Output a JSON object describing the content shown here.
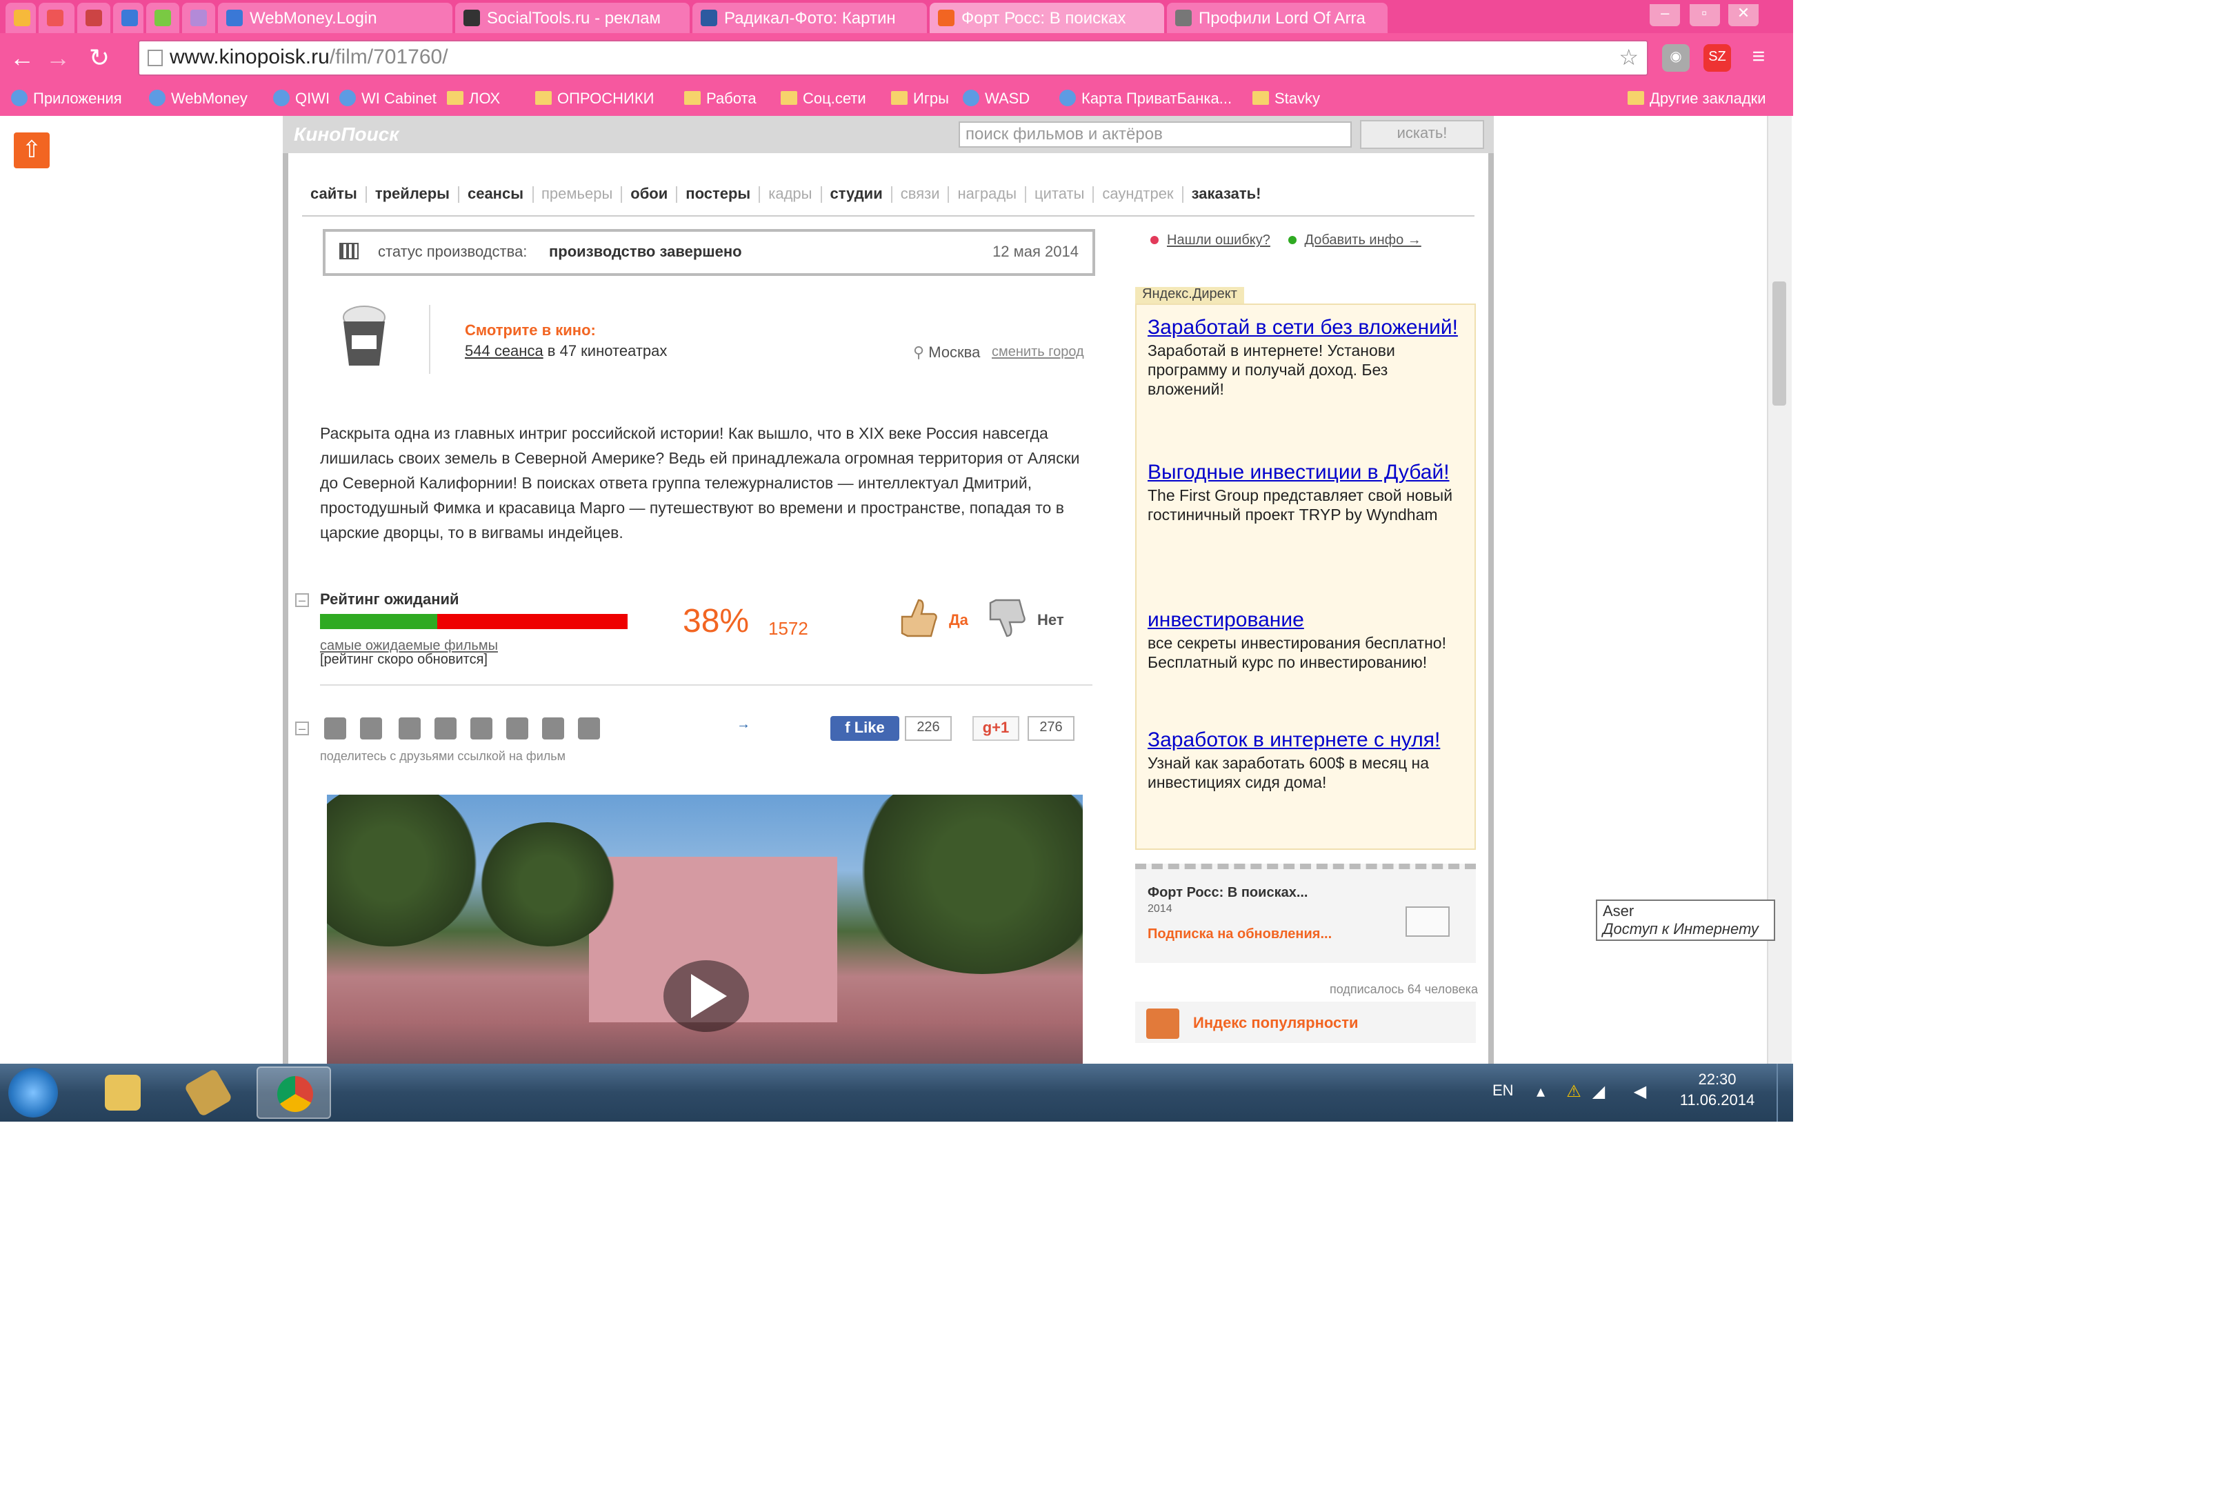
{
  "browser": {
    "tabs": [
      {
        "label": "",
        "color": "#f6b93b"
      },
      {
        "label": "",
        "color": "#e55"
      },
      {
        "label": "",
        "color": "#c44"
      },
      {
        "label": "",
        "color": "#3b7ad8"
      },
      {
        "label": "",
        "color": "#7ac943"
      },
      {
        "label": "",
        "color": "#b38ad8"
      },
      {
        "label": "WebMoney.Login",
        "color": "#3a78d6"
      },
      {
        "label": "SocialTools.ru - реклам",
        "color": "#333"
      },
      {
        "label": "Радикал-Фото: Картин",
        "color": "#2c5aa0"
      },
      {
        "label": "Форт Росс: В поисках",
        "color": "#f26522"
      },
      {
        "label": "Профили Lord Of Arra",
        "color": "#777"
      }
    ],
    "url_host": "www.kinopoisk.ru",
    "url_path": "/film/701760/",
    "window_buttons": [
      "–",
      "▫",
      "✕"
    ],
    "bookmarks": [
      {
        "label": "Приложения",
        "icon": "apps-icon"
      },
      {
        "label": "WebMoney",
        "icon": "webmoney-icon"
      },
      {
        "label": "QIWI",
        "icon": "qiwi-icon"
      },
      {
        "label": "WI Cabinet",
        "icon": "cabinet-icon"
      },
      {
        "label": "ЛОХ",
        "icon": "folder-icon"
      },
      {
        "label": "ОПРОСНИКИ",
        "icon": "folder-icon"
      },
      {
        "label": "Работа",
        "icon": "folder-icon"
      },
      {
        "label": "Соц.сети",
        "icon": "folder-icon"
      },
      {
        "label": "Игры",
        "icon": "folder-icon"
      },
      {
        "label": "WASD",
        "icon": "wasd-icon"
      },
      {
        "label": "Карта ПриватБанка...",
        "icon": "privat-icon"
      },
      {
        "label": "Stavky",
        "icon": "folder-icon"
      }
    ],
    "other_bookmarks": "Другие закладки"
  },
  "site": {
    "logo": "КиноПоиск",
    "search_placeholder": "поиск фильмов и актёров",
    "search_button": "искать!",
    "menu": [
      {
        "label": "сайты",
        "style": "normal"
      },
      {
        "label": "трейлеры",
        "style": "normal"
      },
      {
        "label": "сеансы",
        "style": "normal"
      },
      {
        "label": "премьеры",
        "style": "dim"
      },
      {
        "label": "обои",
        "style": "normal"
      },
      {
        "label": "постеры",
        "style": "normal"
      },
      {
        "label": "кадры",
        "style": "dim"
      },
      {
        "label": "студии",
        "style": "normal"
      },
      {
        "label": "связи",
        "style": "dim"
      },
      {
        "label": "награды",
        "style": "dim"
      },
      {
        "label": "цитаты",
        "style": "dim"
      },
      {
        "label": "саундтрек",
        "style": "dim"
      },
      {
        "label": "заказать!",
        "style": "normal"
      }
    ],
    "status": {
      "label": "статус производства:",
      "value": "производство завершено",
      "date": "12 мая 2014"
    },
    "cinema": {
      "title": "Смотрите в кино:",
      "sessions": "544 сеанса",
      "suffix": " в 47 кинотеатрах",
      "city": "Москва",
      "change_city": "сменить город"
    },
    "description": "Раскрыта одна из главных интриг российской истории! Как вышло, что в XIX веке Россия навсегда лишилась своих земель в Северной Америке? Ведь ей принадлежала огромная территория от Аляски до Северной Калифорнии! В поисках ответа группа тележурналистов — интеллектуал Дмитрий, простодушный Фимка и красавица Марго — путешествуют во времени и пространстве, попадая то в царские дворцы, то в вигвамы индейцев.",
    "rating": {
      "label": "Рейтинг ожиданий",
      "percent_value": 38,
      "percent": "38%",
      "count": "1572",
      "link": "самые ожидаемые фильмы",
      "note": "[рейтинг скоро обновится]",
      "yes": "Да",
      "no": "Нет",
      "bar_green": "#2faa22",
      "bar_red": "#ee0000"
    },
    "share": {
      "like": "Like",
      "like_count": "226",
      "gplus": "g+1",
      "gplus_count": "276",
      "hint": "поделитесь с друзьями ссылкой на фильм",
      "icons": [
        "vk-icon",
        "facebook-icon",
        "twitter-icon",
        "link-icon",
        "livejournal-icon",
        "odnoklassniki-icon",
        "mail-icon",
        "blog-icon"
      ]
    },
    "report": {
      "error": "Нашли ошибку?",
      "add_info": "Добавить инфо →"
    },
    "direct_tag": "Яндекс.Директ",
    "ads": [
      {
        "title": "Заработай в сети без вложений!",
        "text": "Заработай в интернете! Установи программу и получай доход. Без вложений!"
      },
      {
        "title": "Выгодные инвестиции в Дубай!",
        "text": "The First Group представляет свой новый гостиничный проект TRYP by Wyndham"
      },
      {
        "title": "инвестирование",
        "text": "все секреты инвестирования бесплатно! Бесплатный курс по инвестированию!"
      },
      {
        "title": "Заработок в интернете с нуля!",
        "text": "Узнай как заработать 600$ в месяц на инвестициях сидя дома!"
      }
    ],
    "subscribe": {
      "title": "Форт Росс: В поисках...",
      "year": "2014",
      "link": "Подписка на обновления...",
      "count": "подписалось 64 человека"
    },
    "popularity": "Индекс популярности"
  },
  "tooltip": {
    "line1": "Aser",
    "line2": "Доступ к Интернету"
  },
  "taskbar": {
    "lang": "EN",
    "time": "22:30",
    "date": "11.06.2014"
  }
}
